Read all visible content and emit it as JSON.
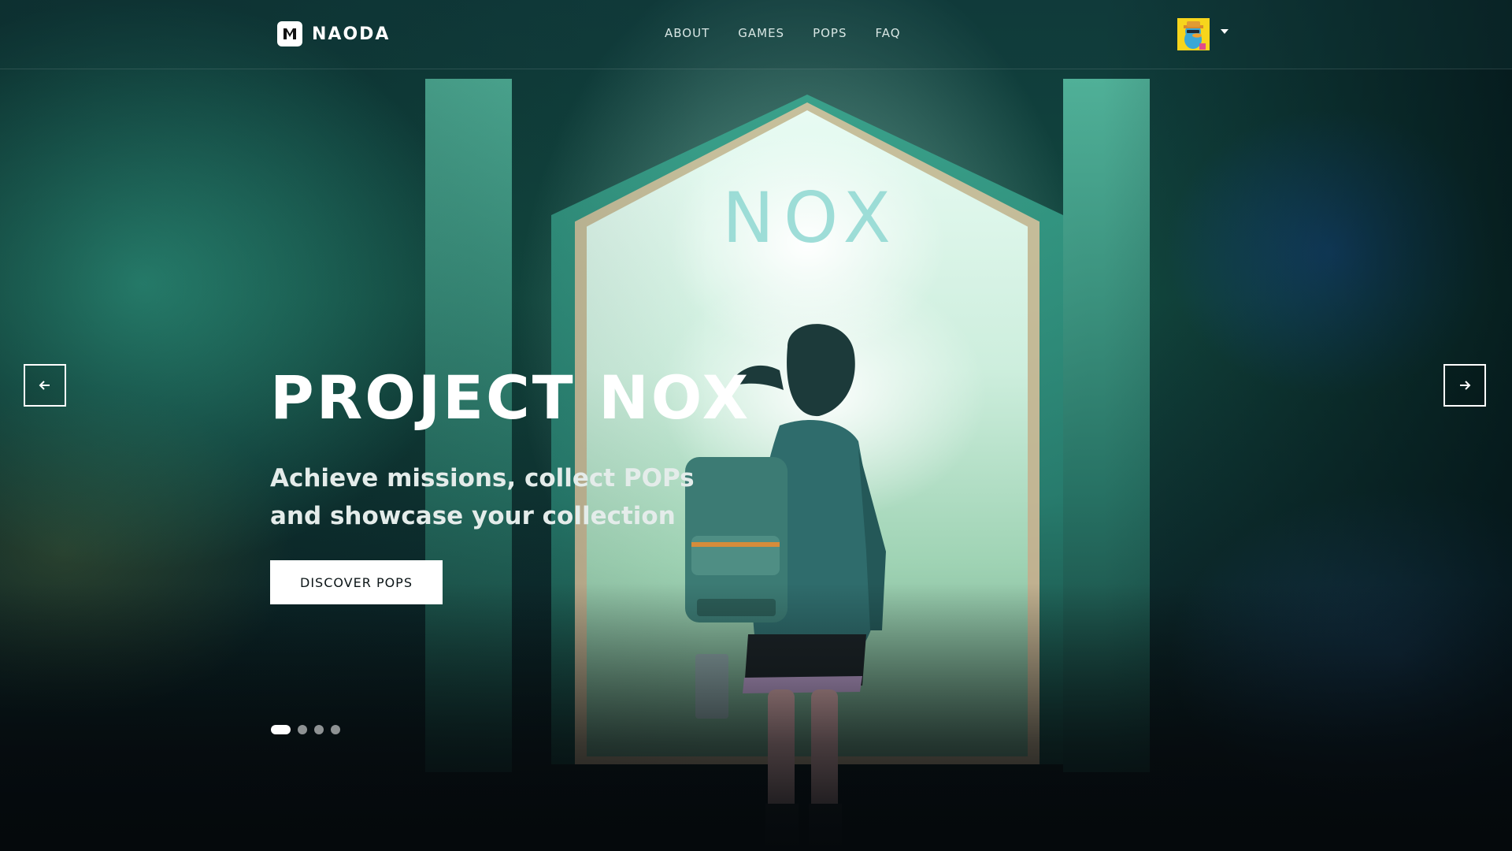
{
  "brand": {
    "name": "NAODA"
  },
  "nav": {
    "items": [
      {
        "label": "ABOUT"
      },
      {
        "label": "GAMES"
      },
      {
        "label": "POPS"
      },
      {
        "label": "FAQ"
      }
    ]
  },
  "account": {
    "avatar": "duck-avatar",
    "menu_icon": "caret-down-icon"
  },
  "hero": {
    "background_sign": "NOX",
    "title": "PROJECT NOX",
    "subtitle_line1": "Achieve missions, collect POPs",
    "subtitle_line2": "and showcase your collection",
    "cta_label": "DISCOVER POPS",
    "prev_icon": "arrow-left-icon",
    "next_icon": "arrow-right-icon",
    "slides_total": 4,
    "active_slide": 1
  },
  "colors": {
    "accent": "#ffffff",
    "teal": "#2a8373",
    "background": "#06141a"
  }
}
